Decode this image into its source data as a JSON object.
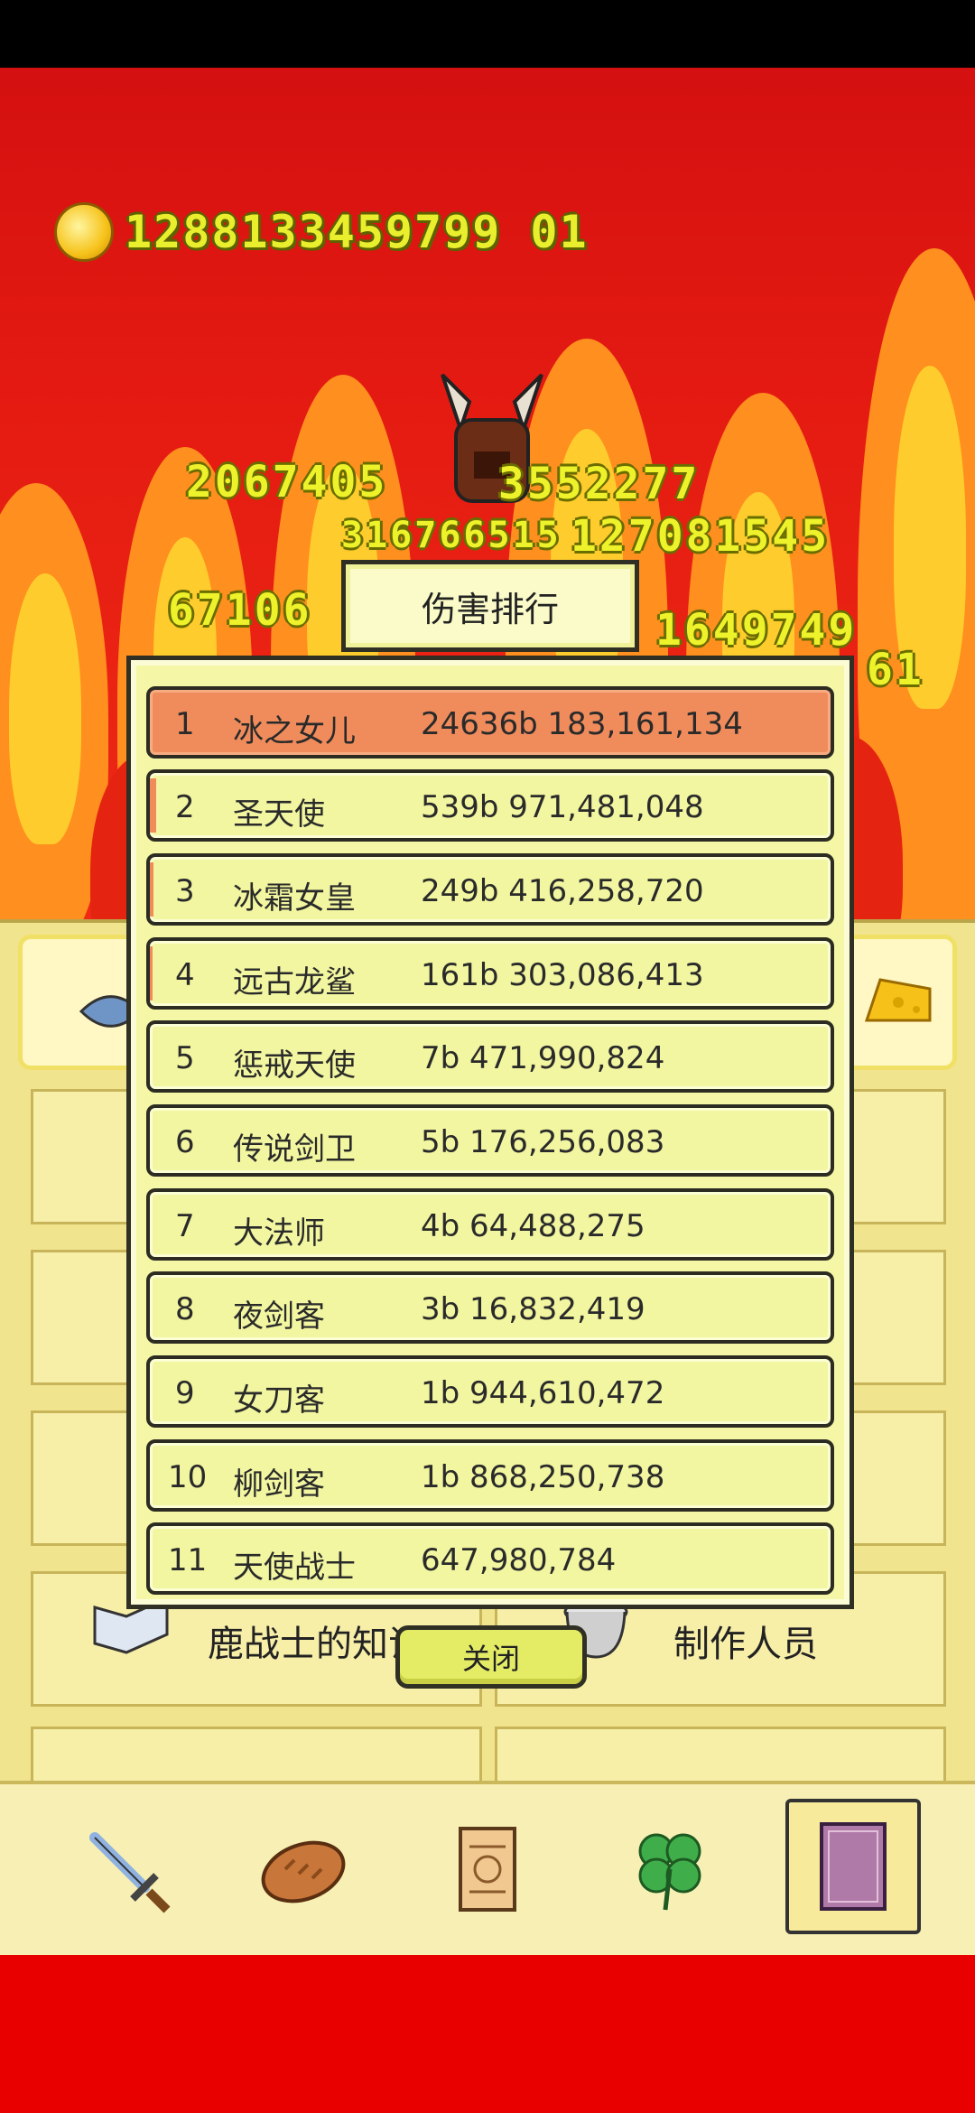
{
  "coin": {
    "icon": "gold-coin-icon",
    "amount": "1288133459799 01"
  },
  "damage_numbers": [
    {
      "text": "2067405"
    },
    {
      "text": "3552277"
    },
    {
      "text": "316766515"
    },
    {
      "text": "127081545"
    },
    {
      "text": "67106"
    },
    {
      "text": "1649749"
    },
    {
      "text": "61"
    }
  ],
  "ranking": {
    "title": "伤害排行",
    "rows": [
      {
        "rank": "1",
        "name": "冰之女儿",
        "damage": "24636b 183,161,134"
      },
      {
        "rank": "2",
        "name": "圣天使",
        "damage": "539b 971,481,048"
      },
      {
        "rank": "3",
        "name": "冰霜女皇",
        "damage": "249b 416,258,720"
      },
      {
        "rank": "4",
        "name": "远古龙鲨",
        "damage": "161b 303,086,413"
      },
      {
        "rank": "5",
        "name": "惩戒天使",
        "damage": "7b 471,990,824"
      },
      {
        "rank": "6",
        "name": "传说剑卫",
        "damage": "5b 176,256,083"
      },
      {
        "rank": "7",
        "name": "大法师",
        "damage": "4b 64,488,275"
      },
      {
        "rank": "8",
        "name": "夜剑客",
        "damage": "3b 16,832,419"
      },
      {
        "rank": "9",
        "name": "女刀客",
        "damage": "1b 944,610,472"
      },
      {
        "rank": "10",
        "name": "柳剑客",
        "damage": "1b 868,250,738"
      },
      {
        "rank": "11",
        "name": "天使战士",
        "damage": "647,980,784"
      }
    ],
    "close_label": "关闭"
  },
  "background_menu": {
    "left_label": "鹿战士的知识",
    "right_label": "制作人员"
  },
  "nav": [
    {
      "icon": "sword-icon"
    },
    {
      "icon": "bread-icon"
    },
    {
      "icon": "scroll-icon"
    },
    {
      "icon": "clover-icon"
    },
    {
      "icon": "book-icon",
      "active": true
    }
  ],
  "colors": {
    "sky_red": "#d60c0c",
    "flame_orange": "#ff8f1e",
    "damage_yellow": "#eef22a",
    "panel_bg": "#f6f7a6",
    "first_place": "#f08c5c"
  }
}
